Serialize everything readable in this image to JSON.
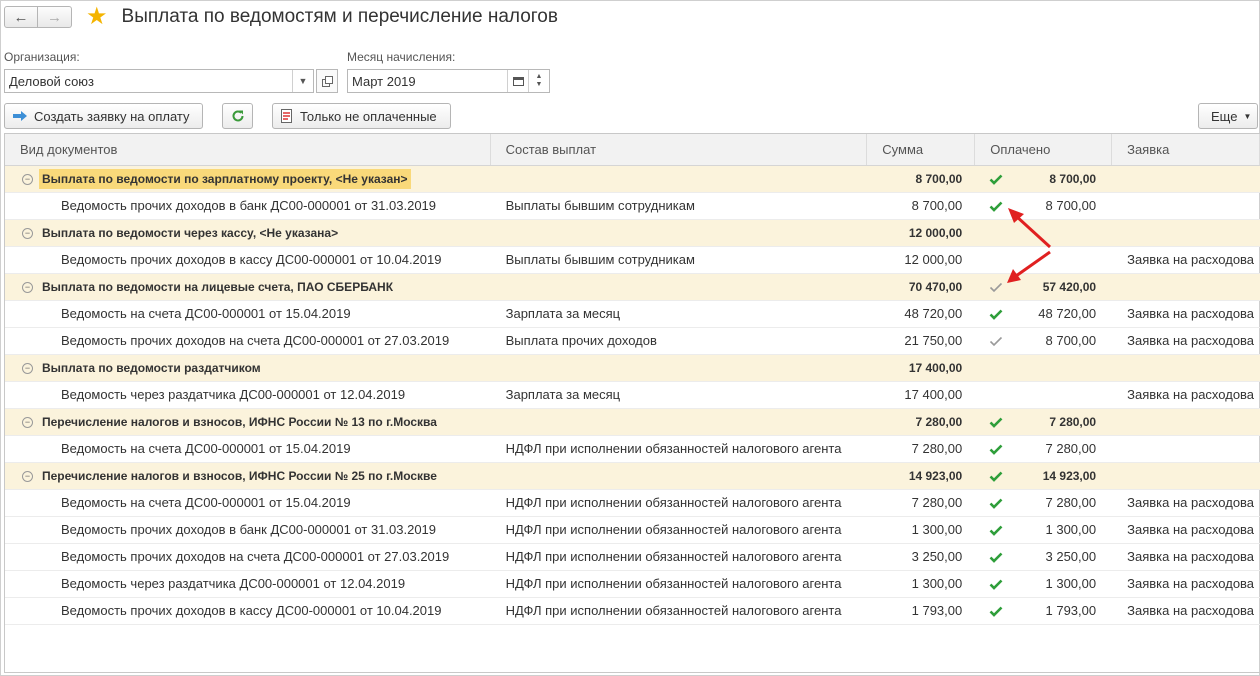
{
  "window": {
    "title": "Выплата по ведомостям и перечисление налогов"
  },
  "filters": {
    "org_label": "Организация:",
    "org_value": "Деловой союз",
    "month_label": "Месяц начисления:",
    "month_value": "Март 2019"
  },
  "toolbar": {
    "create_label": "Создать заявку на оплату",
    "unpaid_label": "Только не оплаченные",
    "more_label": "Еще"
  },
  "columns": [
    "Вид документов",
    "Состав выплат",
    "Сумма",
    "Оплачено",
    "Заявка"
  ],
  "rows": [
    {
      "type": "group",
      "doc": "Выплата по ведомости по зарплатному проекту, <Не указан>",
      "sum": "8 700,00",
      "check": "green",
      "paid": "8 700,00",
      "highlight": true
    },
    {
      "type": "item",
      "doc": "Ведомость прочих доходов в банк ДС00-000001 от 31.03.2019",
      "comp": "Выплаты бывшим сотрудникам",
      "sum": "8 700,00",
      "check": "green",
      "paid": "8 700,00",
      "req": ""
    },
    {
      "type": "group",
      "doc": "Выплата по ведомости через кассу, <Не указана>",
      "sum": "12 000,00",
      "check": "",
      "paid": ""
    },
    {
      "type": "item",
      "doc": "Ведомость прочих доходов в кассу ДС00-000001 от 10.04.2019",
      "comp": "Выплаты бывшим сотрудникам",
      "sum": "12 000,00",
      "check": "",
      "paid": "",
      "req": "Заявка на расходова"
    },
    {
      "type": "group",
      "doc": "Выплата по ведомости на лицевые счета, ПАО СБЕРБАНК",
      "sum": "70 470,00",
      "check": "gray",
      "paid": "57 420,00"
    },
    {
      "type": "item",
      "doc": "Ведомость на счета ДС00-000001 от 15.04.2019",
      "comp": "Зарплата за месяц",
      "sum": "48 720,00",
      "check": "green",
      "paid": "48 720,00",
      "req": "Заявка на расходова"
    },
    {
      "type": "item",
      "doc": "Ведомость прочих доходов на счета ДС00-000001 от 27.03.2019",
      "comp": "Выплата прочих доходов",
      "sum": "21 750,00",
      "check": "gray",
      "paid": "8 700,00",
      "req": "Заявка на расходова"
    },
    {
      "type": "group",
      "doc": "Выплата по ведомости раздатчиком",
      "sum": "17 400,00",
      "check": "",
      "paid": ""
    },
    {
      "type": "item",
      "doc": "Ведомость через раздатчика ДС00-000001 от 12.04.2019",
      "comp": "Зарплата за месяц",
      "sum": "17 400,00",
      "check": "",
      "paid": "",
      "req": "Заявка на расходова"
    },
    {
      "type": "group",
      "doc": "Перечисление налогов и взносов, ИФНС России № 13 по г.Москва",
      "sum": "7 280,00",
      "check": "green",
      "paid": "7 280,00"
    },
    {
      "type": "item",
      "doc": "Ведомость на счета ДС00-000001 от 15.04.2019",
      "comp": "НДФЛ при исполнении обязанностей налогового агента",
      "sum": "7 280,00",
      "check": "green",
      "paid": "7 280,00",
      "req": ""
    },
    {
      "type": "group",
      "doc": "Перечисление налогов и взносов, ИФНС России № 25 по г.Москве",
      "sum": "14 923,00",
      "check": "green",
      "paid": "14 923,00"
    },
    {
      "type": "item",
      "doc": "Ведомость на счета ДС00-000001 от 15.04.2019",
      "comp": "НДФЛ при исполнении обязанностей налогового агента",
      "sum": "7 280,00",
      "check": "green",
      "paid": "7 280,00",
      "req": "Заявка на расходова"
    },
    {
      "type": "item",
      "doc": "Ведомость прочих доходов в банк ДС00-000001 от 31.03.2019",
      "comp": "НДФЛ при исполнении обязанностей налогового агента",
      "sum": "1 300,00",
      "check": "green",
      "paid": "1 300,00",
      "req": "Заявка на расходова"
    },
    {
      "type": "item",
      "doc": "Ведомость прочих доходов на счета ДС00-000001 от 27.03.2019",
      "comp": "НДФЛ при исполнении обязанностей налогового агента",
      "sum": "3 250,00",
      "check": "green",
      "paid": "3 250,00",
      "req": "Заявка на расходова"
    },
    {
      "type": "item",
      "doc": "Ведомость через раздатчика ДС00-000001 от 12.04.2019",
      "comp": "НДФЛ при исполнении обязанностей налогового агента",
      "sum": "1 300,00",
      "check": "green",
      "paid": "1 300,00",
      "req": "Заявка на расходова"
    },
    {
      "type": "item",
      "doc": "Ведомость прочих доходов в кассу ДС00-000001 от 10.04.2019",
      "comp": "НДФЛ при исполнении обязанностей налогового агента",
      "sum": "1 793,00",
      "check": "green",
      "paid": "1 793,00",
      "req": "Заявка на расходова"
    }
  ],
  "colors": {
    "group_bg": "#fbf3dc",
    "highlight": "#f9d97a",
    "check_green": "#2e9e3a",
    "check_gray": "#9a9a9a",
    "arrow": "#e02020"
  }
}
